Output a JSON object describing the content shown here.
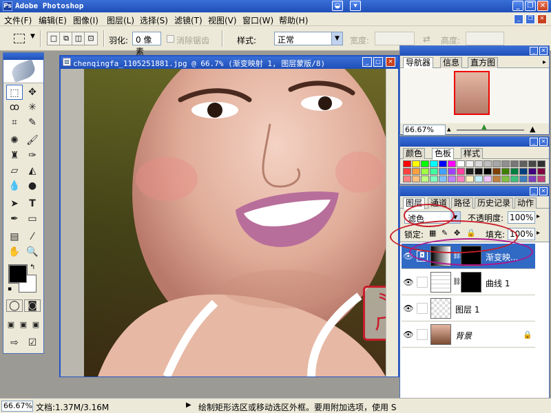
{
  "app": {
    "title": "Adobe Photoshop",
    "icon_label": "Ps"
  },
  "menu": {
    "items": [
      "文件(F)",
      "编辑(E)",
      "图像(I)",
      "图层(L)",
      "选择(S)",
      "滤镜(T)",
      "视图(V)",
      "窗口(W)",
      "帮助(H)"
    ]
  },
  "options": {
    "feather_label": "羽化:",
    "feather_value": "0 像素",
    "antialias_label": "消除锯齿",
    "style_label": "样式:",
    "style_value": "正常",
    "width_label": "宽度:",
    "height_label": "高度:",
    "swap_icon": "swap-icon"
  },
  "document": {
    "title": "chenqingfa_1105251881.jpg @ 66.7% (渐变映射 1, 图层蒙版/8)"
  },
  "navigator": {
    "tabs": [
      "导航器",
      "信息",
      "直方图"
    ],
    "zoom": "66.67%"
  },
  "color_palette": {
    "tabs": [
      "颜色",
      "色板",
      "样式"
    ],
    "swatch_colors": [
      "#ff0000",
      "#ffff00",
      "#00ff00",
      "#00ffff",
      "#0000ff",
      "#ff00ff",
      "#ffffff",
      "#f0f0f0",
      "#d8d8d8",
      "#c0c0c0",
      "#a8a8a8",
      "#909090",
      "#787878",
      "#606060",
      "#484848",
      "#303030",
      "#ff4040",
      "#ffa040",
      "#a0ff40",
      "#40ffa0",
      "#40a0ff",
      "#a040ff",
      "#ff40a0",
      "#202020",
      "#101010",
      "#000000",
      "#7f3f00",
      "#3f7f00",
      "#007f3f",
      "#003f7f",
      "#3f007f",
      "#7f003f",
      "#ff8080",
      "#ffc080",
      "#c0ff80",
      "#80ffc0",
      "#80c0ff",
      "#c080ff",
      "#ff80c0",
      "#fff0c0",
      "#c0f0ff",
      "#f0c0ff",
      "#c08040",
      "#80c040",
      "#40c080",
      "#4080c0",
      "#8040c0",
      "#c04080"
    ]
  },
  "layers": {
    "tabs": [
      "图层",
      "通道",
      "路径",
      "历史记录",
      "动作"
    ],
    "blend_mode": "滤色",
    "opacity_label": "不透明度:",
    "opacity_value": "100%",
    "lock_label": "锁定:",
    "fill_label": "填充:",
    "fill_value": "100%",
    "rows": [
      {
        "name": "渐变映...",
        "active": true
      },
      {
        "name": "曲线 1",
        "active": false
      },
      {
        "name": "图层 1",
        "active": false
      },
      {
        "name": "背景",
        "active": false
      }
    ]
  },
  "status": {
    "zoom": "66.67%",
    "doc": "文档:1.37M/3.16M",
    "hint": "绘制矩形选区或移动选区外框。要用附加选项，使用 S"
  },
  "colors": {
    "accent": "#316ac5",
    "stamp_red": "#c81d2a"
  }
}
